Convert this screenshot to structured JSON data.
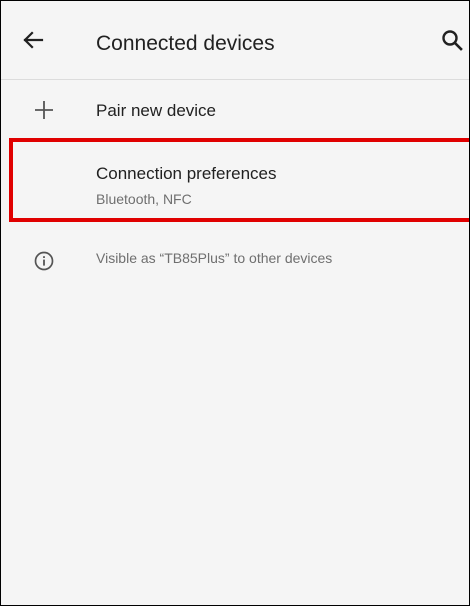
{
  "app_bar": {
    "title": "Connected devices",
    "back_icon": "arrow-back-icon",
    "search_icon": "search-icon"
  },
  "items": {
    "pair": {
      "icon": "plus-icon",
      "label": "Pair new device"
    },
    "preferences": {
      "label": "Connection preferences",
      "summary": "Bluetooth, NFC"
    },
    "visible": {
      "icon": "info-icon",
      "text": "Visible as “TB85Plus” to other devices"
    }
  },
  "colors": {
    "background": "#f5f5f5",
    "primary_text": "#212121",
    "secondary_text": "#6f6f6f",
    "highlight": "#e00000"
  }
}
